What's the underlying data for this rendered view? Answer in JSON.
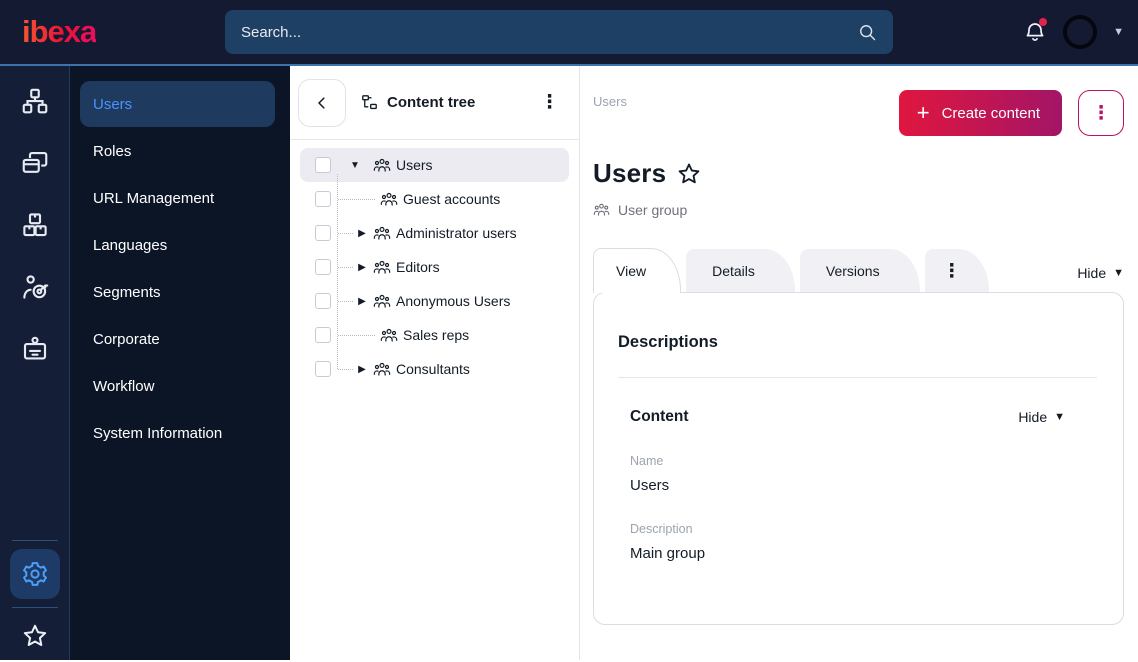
{
  "topbar": {
    "logo_text": "ibexa",
    "search_placeholder": "Search...",
    "icons": [
      "search-icon",
      "bell-icon",
      "avatar",
      "chevron-down-icon"
    ],
    "notification_badge_color": "#E0234C"
  },
  "rail": {
    "icons": [
      "sitemap-icon",
      "windows-icon",
      "boxes-icon",
      "target-person-icon",
      "id-badge-icon",
      "gear-icon",
      "star-icon"
    ],
    "active_icon": "gear-icon",
    "active_color": "#4D9EF8"
  },
  "sidebar": {
    "items": [
      {
        "label": "Users",
        "active": true
      },
      {
        "label": "Roles",
        "active": false
      },
      {
        "label": "URL Management",
        "active": false
      },
      {
        "label": "Languages",
        "active": false
      },
      {
        "label": "Segments",
        "active": false
      },
      {
        "label": "Corporate",
        "active": false
      },
      {
        "label": "Workflow",
        "active": false
      },
      {
        "label": "System Information",
        "active": false
      }
    ],
    "active_text_color": "#4C93FF"
  },
  "content_tree": {
    "title": "Content tree",
    "items": [
      {
        "label": "Users",
        "state": "expanded",
        "selected": true
      },
      {
        "label": "Guest accounts",
        "state": "leaf",
        "selected": false
      },
      {
        "label": "Administrator users",
        "state": "collapsed",
        "selected": false
      },
      {
        "label": "Editors",
        "state": "collapsed",
        "selected": false
      },
      {
        "label": "Anonymous Users",
        "state": "collapsed",
        "selected": false
      },
      {
        "label": "Sales reps",
        "state": "leaf",
        "selected": false
      },
      {
        "label": "Consultants",
        "state": "collapsed",
        "selected": false
      }
    ]
  },
  "main": {
    "breadcrumb": "Users",
    "create_button_label": "Create content",
    "title": "Users",
    "content_type": "User group",
    "tabs": [
      {
        "label": "View",
        "active": true
      },
      {
        "label": "Details",
        "active": false
      },
      {
        "label": "Versions",
        "active": false
      }
    ],
    "hide_label": "Hide",
    "card": {
      "section_title": "Descriptions",
      "subsection_title": "Content",
      "hide_label": "Hide",
      "fields": [
        {
          "label": "Name",
          "value": "Users"
        },
        {
          "label": "Description",
          "value": "Main group"
        }
      ]
    }
  },
  "colors": {
    "topbar_bg": "#141A31",
    "topbar_border": "#3D72AC",
    "rail_bg": "#141E36",
    "sidebar_bg": "#0C1526",
    "selected_item_bg": "#1E3A5F",
    "search_bg": "#1E4065",
    "accent_gradient_start": "#E0163F",
    "accent_gradient_end": "#A31566",
    "accent_magenta": "#B9145E",
    "tree_highlight": "#EBEBF1",
    "text_dark": "#131C26",
    "text_gray": "#9CA3AF"
  }
}
